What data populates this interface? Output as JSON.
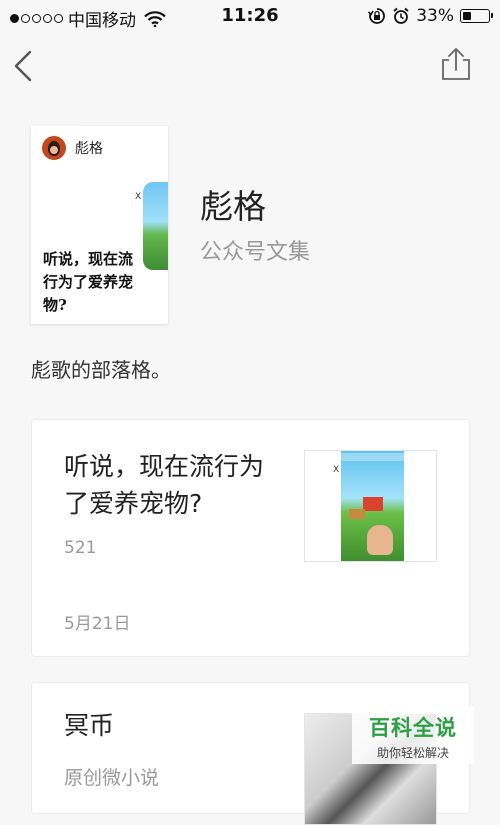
{
  "status_bar": {
    "carrier": "中国移动",
    "time": "11:26",
    "battery": "33%",
    "battery_level": 0.33
  },
  "header": {
    "cover_author": "彪格",
    "cover_title": "听说，现在流行为了爱养宠物?",
    "collection_name": "彪格",
    "collection_subtitle": "公众号文集",
    "description": "彪歌的部落格。"
  },
  "articles": [
    {
      "title": "听说，现在流行为了爱养宠物?",
      "reads": "521",
      "date": "5月21日"
    },
    {
      "title": "冥币",
      "subtitle": "原创微小说"
    }
  ],
  "watermark": {
    "main": "百科全说",
    "sub": "助你轻松解决"
  },
  "icons": {
    "back": "chevron-left-icon",
    "share": "share-icon",
    "wifi": "wifi-icon",
    "lock": "rotation-lock-icon",
    "alarm": "alarm-icon"
  }
}
